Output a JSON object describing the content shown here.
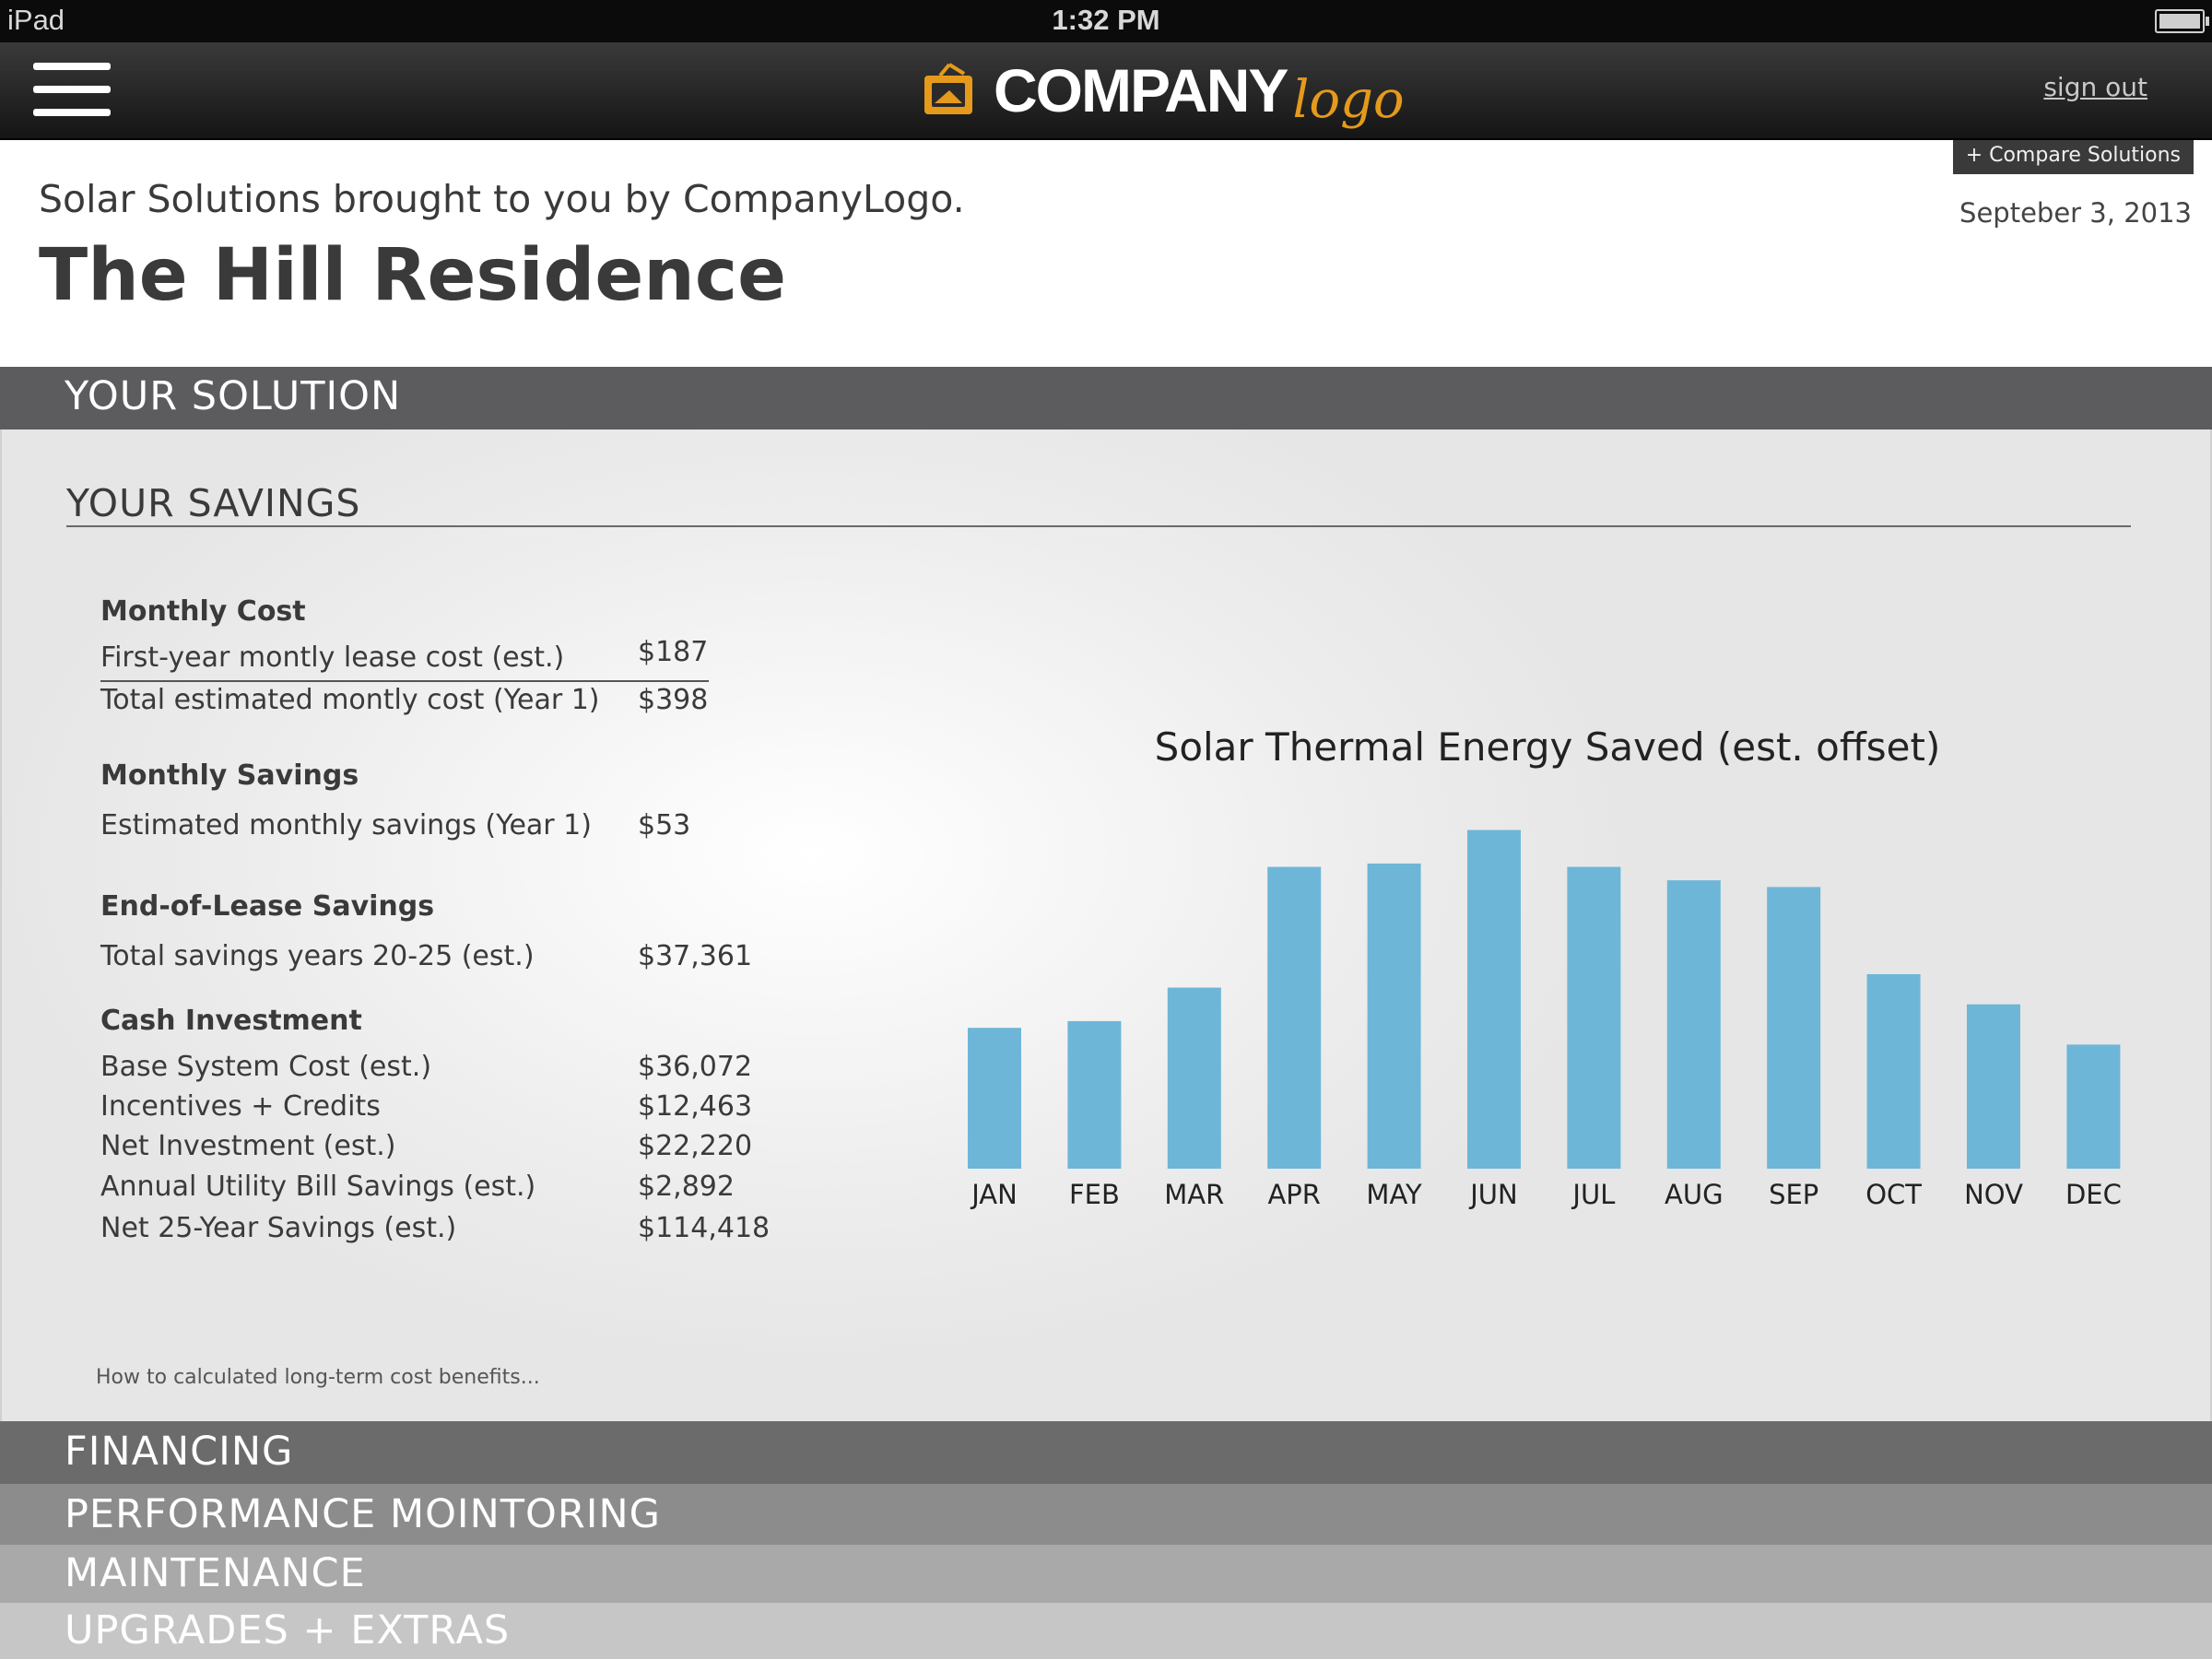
{
  "status_bar": {
    "device": "iPad",
    "time": "1:32 PM"
  },
  "nav": {
    "logo_main": "COMPANY",
    "logo_sub": "logo",
    "sign_out": "sign out",
    "accent_color": "#e59a1c"
  },
  "header": {
    "compare_button": "+ Compare Solutions",
    "tagline": "Solar Solutions brought to you by CompanyLogo.",
    "date": "Septeber 3, 2013",
    "residence": "The Hill Residence"
  },
  "sections": {
    "solution": "YOUR SOLUTION",
    "financing": "FINANCING",
    "performance": "PERFORMANCE MOINTORING",
    "maintenance": "MAINTENANCE",
    "upgrades": "UPGRADES + EXTRAS"
  },
  "savings": {
    "title": "YOUR SAVINGS",
    "monthly_cost": {
      "title": "Monthly Cost",
      "rows": [
        {
          "label": "First-year montly lease cost (est.)",
          "value": "$187"
        },
        {
          "label": "Total estimated montly cost (Year 1)",
          "value": "$398"
        }
      ]
    },
    "monthly_savings": {
      "title": "Monthly Savings",
      "rows": [
        {
          "label": "Estimated monthly savings (Year 1)",
          "value": "$53"
        }
      ]
    },
    "end_of_lease": {
      "title": "End-of-Lease Savings",
      "rows": [
        {
          "label": "Total savings years 20-25  (est.)",
          "value": "$37,361"
        }
      ]
    },
    "cash_investment": {
      "title": "Cash Investment",
      "rows": [
        {
          "label": "Base System Cost (est.)",
          "value": "$36,072"
        },
        {
          "label": "Incentives + Credits",
          "value": "$12,463"
        },
        {
          "label": "Net Investment (est.)",
          "value": "$22,220"
        },
        {
          "label": "Annual Utility Bill Savings (est.)",
          "value": "$2,892"
        },
        {
          "label": "Net 25-Year Savings (est.)",
          "value": "$114,418"
        }
      ]
    },
    "footer_link": "How to calculated long-term cost benefits..."
  },
  "chart_data": {
    "type": "bar",
    "title": "Solar Thermal Energy Saved (est. offset)",
    "categories": [
      "JAN",
      "FEB",
      "MAR",
      "APR",
      "MAY",
      "JUN",
      "JUL",
      "AUG",
      "SEP",
      "OCT",
      "NOV",
      "DEC"
    ],
    "values": [
      42,
      44,
      54,
      90,
      91,
      101,
      90,
      86,
      84,
      58,
      49,
      37
    ],
    "ylim": [
      0,
      105
    ],
    "grid": false,
    "bar_color": "#6db6d8"
  }
}
